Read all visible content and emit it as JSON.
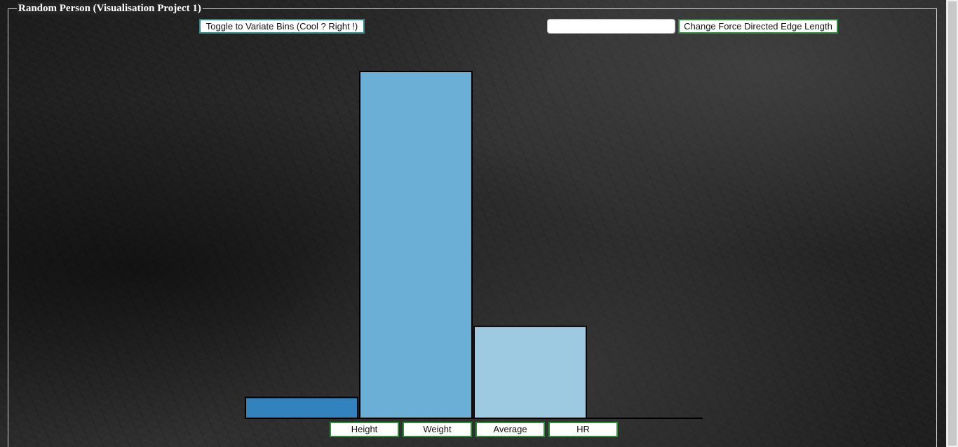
{
  "page": {
    "title": "Random Person (Visualisation Project 1)"
  },
  "controls": {
    "toggle_bins_label": "Toggle to Variate Bins (Cool ? Right !)",
    "edge_length_value": "",
    "edge_length_placeholder": "",
    "edge_length_button_label": "Change Force Directed Edge Length"
  },
  "category_buttons": [
    {
      "label": "Height"
    },
    {
      "label": "Weight"
    },
    {
      "label": "Average"
    },
    {
      "label": "HR"
    }
  ],
  "colors": {
    "bar_dark": "#3182bd",
    "bar_mid": "#6baed6",
    "bar_light": "#9ecae1",
    "bar_stroke": "#000000",
    "button_border_green": "#2e8b3a",
    "button_border_teal": "#2e8b8b"
  },
  "chart_data": {
    "type": "bar",
    "bars": [
      {
        "value": 6,
        "color": "#3182bd"
      },
      {
        "value": 100,
        "color": "#6baed6"
      },
      {
        "value": 26.5,
        "color": "#9ecae1"
      },
      {
        "value": 0,
        "color": "#c6dbef"
      }
    ],
    "ylim": [
      0,
      100
    ],
    "title": "",
    "xlabel": "",
    "ylabel": ""
  }
}
